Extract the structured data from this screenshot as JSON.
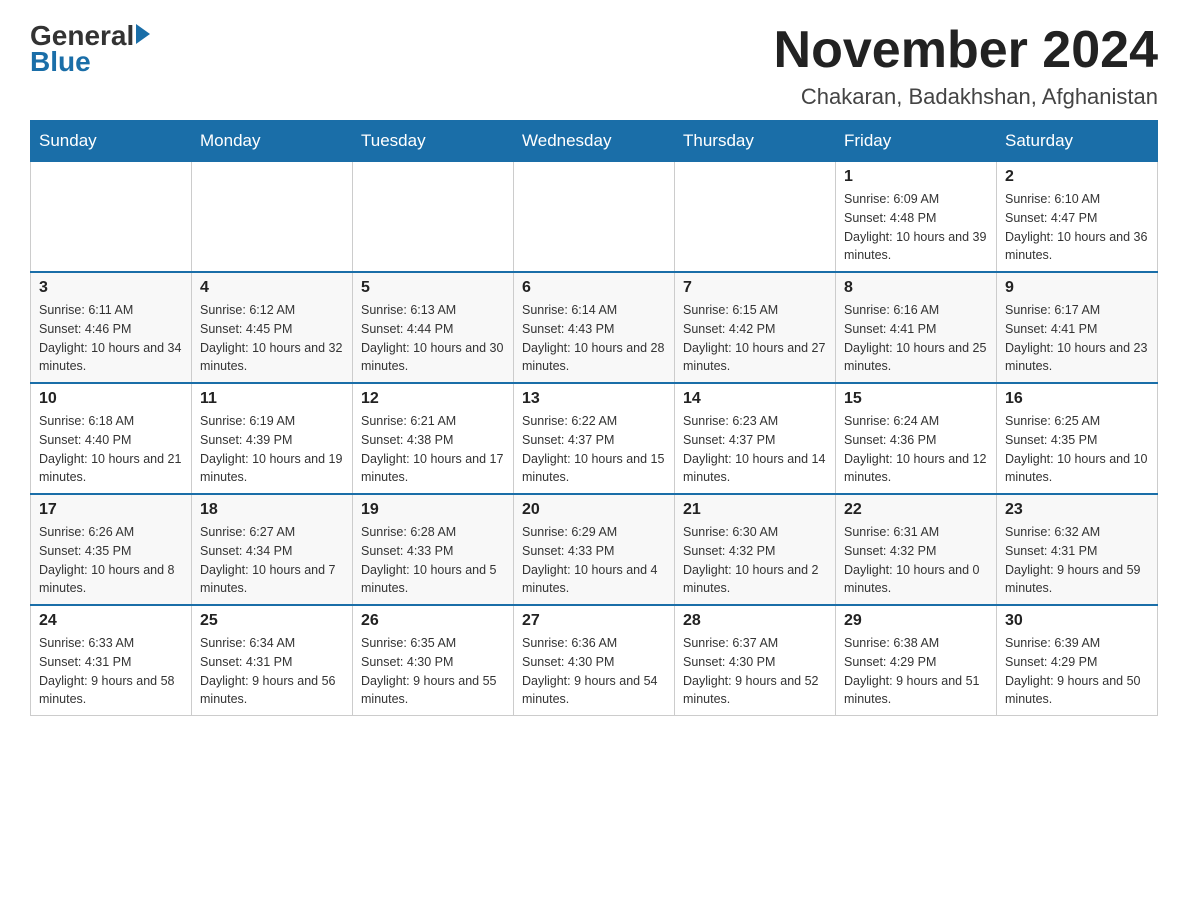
{
  "logo": {
    "general": "General",
    "blue": "Blue"
  },
  "title": "November 2024",
  "location": "Chakaran, Badakhshan, Afghanistan",
  "days_of_week": [
    "Sunday",
    "Monday",
    "Tuesday",
    "Wednesday",
    "Thursday",
    "Friday",
    "Saturday"
  ],
  "weeks": [
    [
      {
        "day": "",
        "info": ""
      },
      {
        "day": "",
        "info": ""
      },
      {
        "day": "",
        "info": ""
      },
      {
        "day": "",
        "info": ""
      },
      {
        "day": "",
        "info": ""
      },
      {
        "day": "1",
        "info": "Sunrise: 6:09 AM\nSunset: 4:48 PM\nDaylight: 10 hours and 39 minutes."
      },
      {
        "day": "2",
        "info": "Sunrise: 6:10 AM\nSunset: 4:47 PM\nDaylight: 10 hours and 36 minutes."
      }
    ],
    [
      {
        "day": "3",
        "info": "Sunrise: 6:11 AM\nSunset: 4:46 PM\nDaylight: 10 hours and 34 minutes."
      },
      {
        "day": "4",
        "info": "Sunrise: 6:12 AM\nSunset: 4:45 PM\nDaylight: 10 hours and 32 minutes."
      },
      {
        "day": "5",
        "info": "Sunrise: 6:13 AM\nSunset: 4:44 PM\nDaylight: 10 hours and 30 minutes."
      },
      {
        "day": "6",
        "info": "Sunrise: 6:14 AM\nSunset: 4:43 PM\nDaylight: 10 hours and 28 minutes."
      },
      {
        "day": "7",
        "info": "Sunrise: 6:15 AM\nSunset: 4:42 PM\nDaylight: 10 hours and 27 minutes."
      },
      {
        "day": "8",
        "info": "Sunrise: 6:16 AM\nSunset: 4:41 PM\nDaylight: 10 hours and 25 minutes."
      },
      {
        "day": "9",
        "info": "Sunrise: 6:17 AM\nSunset: 4:41 PM\nDaylight: 10 hours and 23 minutes."
      }
    ],
    [
      {
        "day": "10",
        "info": "Sunrise: 6:18 AM\nSunset: 4:40 PM\nDaylight: 10 hours and 21 minutes."
      },
      {
        "day": "11",
        "info": "Sunrise: 6:19 AM\nSunset: 4:39 PM\nDaylight: 10 hours and 19 minutes."
      },
      {
        "day": "12",
        "info": "Sunrise: 6:21 AM\nSunset: 4:38 PM\nDaylight: 10 hours and 17 minutes."
      },
      {
        "day": "13",
        "info": "Sunrise: 6:22 AM\nSunset: 4:37 PM\nDaylight: 10 hours and 15 minutes."
      },
      {
        "day": "14",
        "info": "Sunrise: 6:23 AM\nSunset: 4:37 PM\nDaylight: 10 hours and 14 minutes."
      },
      {
        "day": "15",
        "info": "Sunrise: 6:24 AM\nSunset: 4:36 PM\nDaylight: 10 hours and 12 minutes."
      },
      {
        "day": "16",
        "info": "Sunrise: 6:25 AM\nSunset: 4:35 PM\nDaylight: 10 hours and 10 minutes."
      }
    ],
    [
      {
        "day": "17",
        "info": "Sunrise: 6:26 AM\nSunset: 4:35 PM\nDaylight: 10 hours and 8 minutes."
      },
      {
        "day": "18",
        "info": "Sunrise: 6:27 AM\nSunset: 4:34 PM\nDaylight: 10 hours and 7 minutes."
      },
      {
        "day": "19",
        "info": "Sunrise: 6:28 AM\nSunset: 4:33 PM\nDaylight: 10 hours and 5 minutes."
      },
      {
        "day": "20",
        "info": "Sunrise: 6:29 AM\nSunset: 4:33 PM\nDaylight: 10 hours and 4 minutes."
      },
      {
        "day": "21",
        "info": "Sunrise: 6:30 AM\nSunset: 4:32 PM\nDaylight: 10 hours and 2 minutes."
      },
      {
        "day": "22",
        "info": "Sunrise: 6:31 AM\nSunset: 4:32 PM\nDaylight: 10 hours and 0 minutes."
      },
      {
        "day": "23",
        "info": "Sunrise: 6:32 AM\nSunset: 4:31 PM\nDaylight: 9 hours and 59 minutes."
      }
    ],
    [
      {
        "day": "24",
        "info": "Sunrise: 6:33 AM\nSunset: 4:31 PM\nDaylight: 9 hours and 58 minutes."
      },
      {
        "day": "25",
        "info": "Sunrise: 6:34 AM\nSunset: 4:31 PM\nDaylight: 9 hours and 56 minutes."
      },
      {
        "day": "26",
        "info": "Sunrise: 6:35 AM\nSunset: 4:30 PM\nDaylight: 9 hours and 55 minutes."
      },
      {
        "day": "27",
        "info": "Sunrise: 6:36 AM\nSunset: 4:30 PM\nDaylight: 9 hours and 54 minutes."
      },
      {
        "day": "28",
        "info": "Sunrise: 6:37 AM\nSunset: 4:30 PM\nDaylight: 9 hours and 52 minutes."
      },
      {
        "day": "29",
        "info": "Sunrise: 6:38 AM\nSunset: 4:29 PM\nDaylight: 9 hours and 51 minutes."
      },
      {
        "day": "30",
        "info": "Sunrise: 6:39 AM\nSunset: 4:29 PM\nDaylight: 9 hours and 50 minutes."
      }
    ]
  ]
}
